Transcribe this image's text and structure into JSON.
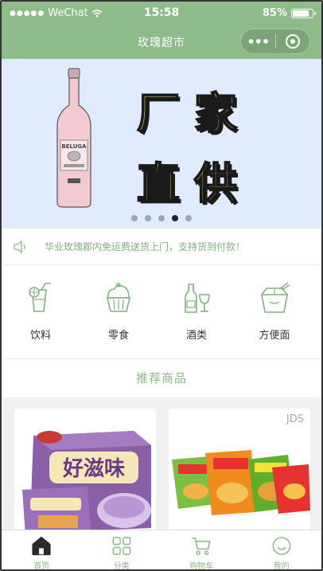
{
  "status_bar": {
    "carrier": "WeChat",
    "time": "15:58",
    "battery": "85%",
    "battery_level": 0.85
  },
  "nav": {
    "title": "玫瑰超市",
    "more_label": "•••",
    "close_icon": "record-circle-icon"
  },
  "banner": {
    "line1": "厂家",
    "line2": "直供",
    "bottle_brand": "BELUGA",
    "slide_count": 5,
    "active_slide": 4
  },
  "notice": {
    "icon": "speaker-icon",
    "text": "华业玫瑰郡内免运费送货上门，支持货到付款！"
  },
  "categories": [
    {
      "label": "饮料",
      "icon": "drink-icon"
    },
    {
      "label": "零食",
      "icon": "cupcake-icon"
    },
    {
      "label": "酒类",
      "icon": "wine-icon"
    },
    {
      "label": "方便面",
      "icon": "noodle-box-icon"
    }
  ],
  "recommend": {
    "title": "推荐商品"
  },
  "products": [
    {
      "image": "milk-tea-box",
      "brand_text": "好滋味"
    },
    {
      "image": "instant-noodle-packs",
      "watermark": "JDS"
    }
  ],
  "tabbar": [
    {
      "label": "首页",
      "icon": "home-icon",
      "active": true
    },
    {
      "label": "分类",
      "icon": "grid-icon",
      "active": false
    },
    {
      "label": "购物车",
      "icon": "cart-icon",
      "active": false
    },
    {
      "label": "我的",
      "icon": "smile-icon",
      "active": false
    }
  ],
  "colors": {
    "theme_green": "#8dbb8a",
    "accent_text": "#8bb987",
    "banner_bg": "#e0ecfc"
  }
}
